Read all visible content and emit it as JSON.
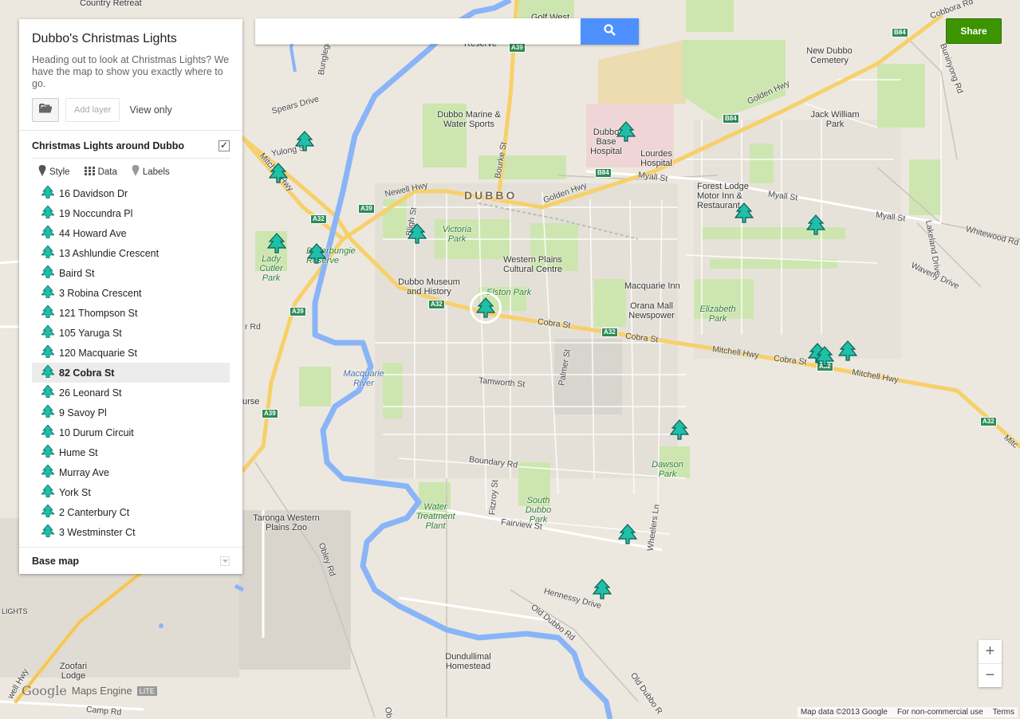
{
  "app": {
    "brand_google": "Google",
    "brand_product": "Maps Engine",
    "brand_badge": "LITE"
  },
  "panel": {
    "title": "Dubbo's Christmas Lights",
    "description": "Heading out to look at Christmas Lights? We have the map to show you exactly where to go.",
    "add_layer_label": "Add layer",
    "view_only_label": "View only",
    "layer": {
      "title": "Christmas Lights around Dubbo",
      "checked": true,
      "tools": {
        "style": "Style",
        "data": "Data",
        "labels": "Labels"
      },
      "places": [
        "16 Davidson Dr",
        "19 Noccundra Pl",
        "44 Howard Ave",
        "13 Ashlundie Crescent",
        "Baird St",
        "3 Robina Crescent",
        "121 Thompson St",
        "105 Yaruga St",
        "120 Macquarie St",
        "82 Cobra St",
        "26 Leonard St",
        "9 Savoy Pl",
        "10 Durum Circuit",
        "Hume St",
        "Murray Ave",
        "York St",
        "2 Canterbury Ct",
        "3 Westminster Ct"
      ],
      "selected_place": "82 Cobra St"
    },
    "base_map_label": "Base map"
  },
  "search": {
    "value": "",
    "placeholder": ""
  },
  "share_label": "Share",
  "zoom": {
    "in": "+",
    "out": "−"
  },
  "footer": {
    "map_data": "Map data ©2013 Google",
    "license": "For non-commercial use",
    "terms": "Terms"
  },
  "colors": {
    "marker": "#1fbfa8",
    "accent_blue": "#4d90fe",
    "share_green": "#3d9400",
    "park_green": "#cde6b0",
    "river": "#8ab4f8",
    "highway": "#f7d06a"
  },
  "map_labels": {
    "country_retreat": "Country Retreat",
    "golf_west": "Golf West",
    "reserve_top": "Reserve",
    "new_dubbo_cemetery": "New Dubbo Cemetery",
    "buninyong_rd": "Buninyong Rd",
    "cobbora_rd": "Cobbora Rd",
    "bunglegumbie": "Bunglegumbie",
    "spears_drive": "Spears Drive",
    "dubbo_marine": "Dubbo Marine & Water Sports",
    "dubbo_base_hospital": "Dubbo Base Hospital",
    "lourdes_hospital": "Lourdes Hospital",
    "golden_hwy_1": "Golden Hwy",
    "golden_hwy_2": "Golden Hwy",
    "jack_william_park": "Jack William Park",
    "yulong_st": "Yulong St",
    "bourke_st": "Bourke St",
    "mitchell_hwy_w": "Mitchell Hwy",
    "newell_hwy": "Newell Hwy",
    "dubbo": "DUBBO",
    "myall_st_1": "Myall St",
    "myall_st_2": "Myall St",
    "myall_st_3": "Myall St",
    "forest_lodge": "Forest Lodge Motor Inn & Restaurant",
    "bligh_st": "Bligh St",
    "victoria_park": "Victoria Park",
    "lakeland_drive": "Lakeland Drive",
    "whitewood_rd": "Whitewood Rd",
    "waverly_drive": "Waverly Drive",
    "lady_cutler_park": "Lady Cutler Park",
    "butlerbungie_reserve": "Butlerbungie Reserve",
    "western_plains_cultural_centre": "Western Plains Cultural Centre",
    "dubbo_museum": "Dubbo Museum and History",
    "elston_park": "Elston Park",
    "macquarie_inn": "Macquarie Inn",
    "orana_mall": "Orana Mall Newspower",
    "elizabeth_park": "Elizabeth Park",
    "r_rd": "r Rd",
    "cobra_st_1": "Cobra St",
    "cobra_st_2": "Cobra St",
    "cobra_st_3": "Cobra St",
    "mitchell_hwy_1": "Mitchell Hwy",
    "mitchell_hwy_2": "Mitchell Hwy",
    "mitc": "Mitc",
    "palmer_st": "Palmer St",
    "macquarie_river": "Macquarie River",
    "tamworth_st": "Tamworth St",
    "urse": "urse",
    "dawson_park": "Dawson Park",
    "boundary_rd": "Boundary Rd",
    "fitzroy_st": "Fitzroy St",
    "south_dubbo_park": "South Dubbo Park",
    "water_treatment_plant": "Water Treatment Plant",
    "fairview_st": "Fairview St",
    "wheelers_ln": "Wheelers Ln",
    "taronga_zoo": "Taronga Western Plains Zoo",
    "obley_rd": "Obley Rd",
    "hennessy_drive": "Hennessy Drive",
    "old_dubbo_rd_1": "Old Dubbo Rd",
    "old_dubbo_rd_2": "Old Dubbo R",
    "lights": "LIGHTS",
    "dundullimal": "Dundullimal Homestead",
    "zoofari_lodge": "Zoofari Lodge",
    "camp_rd": "Camp Rd",
    "well_hwy": "well Hwy",
    "ob": "Ob",
    "shield_a39": "A39",
    "shield_a32": "A32",
    "shield_b84": "B84"
  }
}
